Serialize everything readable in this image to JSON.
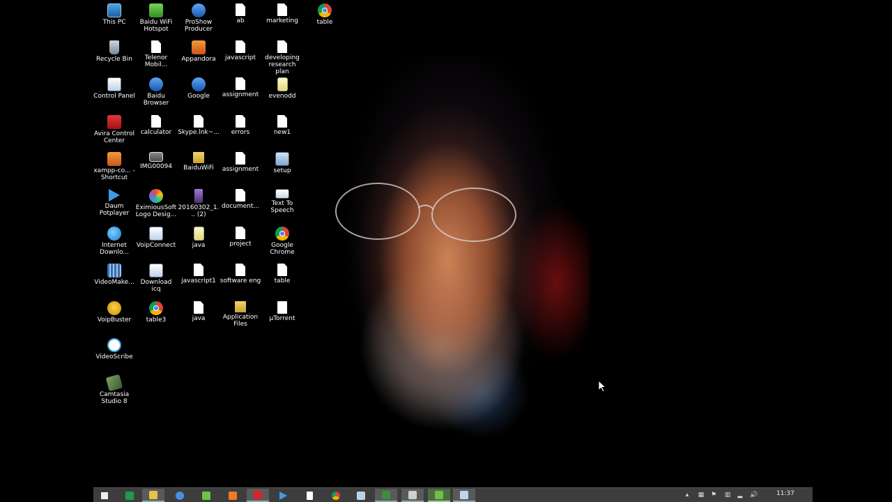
{
  "desktop": {
    "icons": [
      {
        "label": "This PC",
        "icon": "computer-icon"
      },
      {
        "label": "Baidu WiFi Hotspot",
        "icon": "wifi-hotspot-icon"
      },
      {
        "label": "ProShow Producer",
        "icon": "proshow-icon"
      },
      {
        "label": "ab",
        "icon": "document-icon"
      },
      {
        "label": "marketing",
        "icon": "document-icon"
      },
      {
        "label": "table",
        "icon": "chrome-icon"
      },
      {
        "label": "Recycle Bin",
        "icon": "recycle-bin-icon"
      },
      {
        "label": "Telenor Mobil...",
        "icon": "document-icon"
      },
      {
        "label": "Appandora",
        "icon": "appandora-icon"
      },
      {
        "label": "javascript",
        "icon": "document-icon"
      },
      {
        "label": "developing research plan",
        "icon": "document-icon"
      },
      {
        "label": "Control Panel",
        "icon": "control-panel-icon"
      },
      {
        "label": "Baidu Browser",
        "icon": "baidu-browser-icon"
      },
      {
        "label": "Google",
        "icon": "google-icon"
      },
      {
        "label": "assignment",
        "icon": "document-icon"
      },
      {
        "label": "evenodd",
        "icon": "notepad-icon"
      },
      {
        "label": "Avira Control Center",
        "icon": "avira-icon"
      },
      {
        "label": "calculator",
        "icon": "document-icon"
      },
      {
        "label": "Skype.lnk~...",
        "icon": "document-icon"
      },
      {
        "label": "errors",
        "icon": "document-icon"
      },
      {
        "label": "new1",
        "icon": "document-icon"
      },
      {
        "label": "xampp-co... - Shortcut",
        "icon": "xampp-icon"
      },
      {
        "label": "IMG00094",
        "icon": "photo-icon"
      },
      {
        "label": "BaiduWiFi",
        "icon": "folder-icon"
      },
      {
        "label": "assignment",
        "icon": "document-icon"
      },
      {
        "label": "setup",
        "icon": "setup-icon"
      },
      {
        "label": "Daum Potplayer",
        "icon": "potplayer-icon"
      },
      {
        "label": "EximiousSoft Logo Desig...",
        "icon": "eximioussoft-icon"
      },
      {
        "label": "20160302_1... (2)",
        "icon": "video-file-icon"
      },
      {
        "label": "document...",
        "icon": "document-icon"
      },
      {
        "label": "Text To Speech",
        "icon": "text-to-speech-icon"
      },
      {
        "label": "Internet Downlo...",
        "icon": "idm-icon"
      },
      {
        "label": "VoipConnect",
        "icon": "voipconnect-icon"
      },
      {
        "label": "java",
        "icon": "notepad-icon"
      },
      {
        "label": "project",
        "icon": "document-icon"
      },
      {
        "label": "Google Chrome",
        "icon": "chrome-icon"
      },
      {
        "label": "VideoMake...",
        "icon": "videomaker-icon"
      },
      {
        "label": "Download icq",
        "icon": "icq-installer-icon"
      },
      {
        "label": "javascript1",
        "icon": "document-icon"
      },
      {
        "label": "software eng",
        "icon": "document-icon"
      },
      {
        "label": "table",
        "icon": "document-icon"
      },
      {
        "label": "VoipBuster",
        "icon": "voipbuster-icon"
      },
      {
        "label": "table3",
        "icon": "chrome-icon"
      },
      {
        "label": "java",
        "icon": "document-icon"
      },
      {
        "label": "Application Files",
        "icon": "folder-icon"
      },
      {
        "label": "µTorrent",
        "icon": "utorrent-icon"
      },
      {
        "label": "VideoScribe",
        "icon": "videoscribe-icon"
      },
      {
        "label": "Camtasia Studio 8",
        "icon": "camtasia-icon"
      }
    ]
  },
  "taskbar": {
    "buttons": [
      {
        "icon": "windows-start-icon"
      },
      {
        "icon": "excel-icon"
      },
      {
        "icon": "file-explorer-icon",
        "state": "active"
      },
      {
        "icon": "baidu-browser-icon"
      },
      {
        "icon": "wifi-hotspot-icon"
      },
      {
        "icon": "xampp-icon"
      },
      {
        "icon": "avira-icon",
        "state": "active"
      },
      {
        "icon": "potplayer-icon"
      },
      {
        "icon": "document-icon"
      },
      {
        "icon": "chrome-icon"
      },
      {
        "icon": "control-panel-icon"
      },
      {
        "icon": "camtasia-recorder-icon",
        "state": "active"
      },
      {
        "icon": "game-controller-icon",
        "state": "active"
      },
      {
        "icon": "camtasia-icon",
        "state": "active"
      },
      {
        "icon": "notepad-icon",
        "state": "active"
      }
    ],
    "tray": {
      "icons": [
        "show-hidden-icons-chevron-icon",
        "windows-icon",
        "action-center-flag-icon",
        "power-plug-icon",
        "network-signal-icon",
        "volume-icon"
      ],
      "clock": "11:37"
    }
  }
}
